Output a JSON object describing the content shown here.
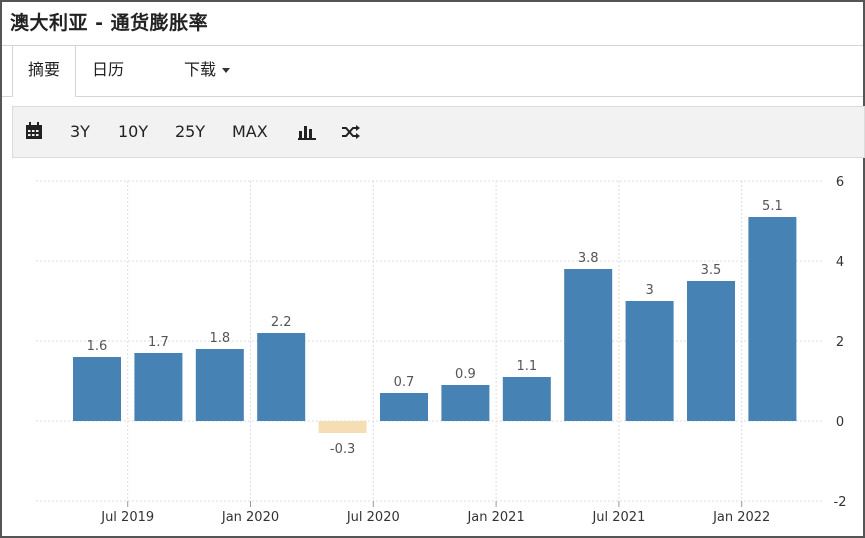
{
  "header": {
    "title": "澳大利亚 - 通货膨胀率"
  },
  "tabs": [
    {
      "label": "摘要"
    },
    {
      "label": "日历"
    },
    {
      "label": "下载"
    }
  ],
  "toolbar": {
    "calendar_icon": "calendar-icon",
    "ranges": [
      "3Y",
      "10Y",
      "25Y",
      "MAX"
    ],
    "bar_icon": "bar-chart-icon",
    "shuffle_icon": "shuffle-icon"
  },
  "colors": {
    "positive": "#4682b4",
    "negative": "#f5deb3"
  },
  "chart_data": {
    "type": "bar",
    "categories": [
      "2019-06",
      "2019-09",
      "2019-12",
      "2020-03",
      "2020-06",
      "2020-09",
      "2020-12",
      "2021-03",
      "2021-06",
      "2021-09",
      "2021-12",
      "2022-03"
    ],
    "values": [
      1.6,
      1.7,
      1.8,
      2.2,
      -0.3,
      0.7,
      0.9,
      1.1,
      3.8,
      3,
      3.5,
      5.1
    ],
    "x_ticks": [
      "Jul 2019",
      "Jan 2020",
      "Jul 2020",
      "Jan 2021",
      "Jul 2021",
      "Jan 2022"
    ],
    "y_ticks": [
      -2,
      0,
      2,
      4,
      6
    ],
    "ylim": [
      -2,
      6
    ],
    "grid": true,
    "y_axis_side": "right"
  }
}
